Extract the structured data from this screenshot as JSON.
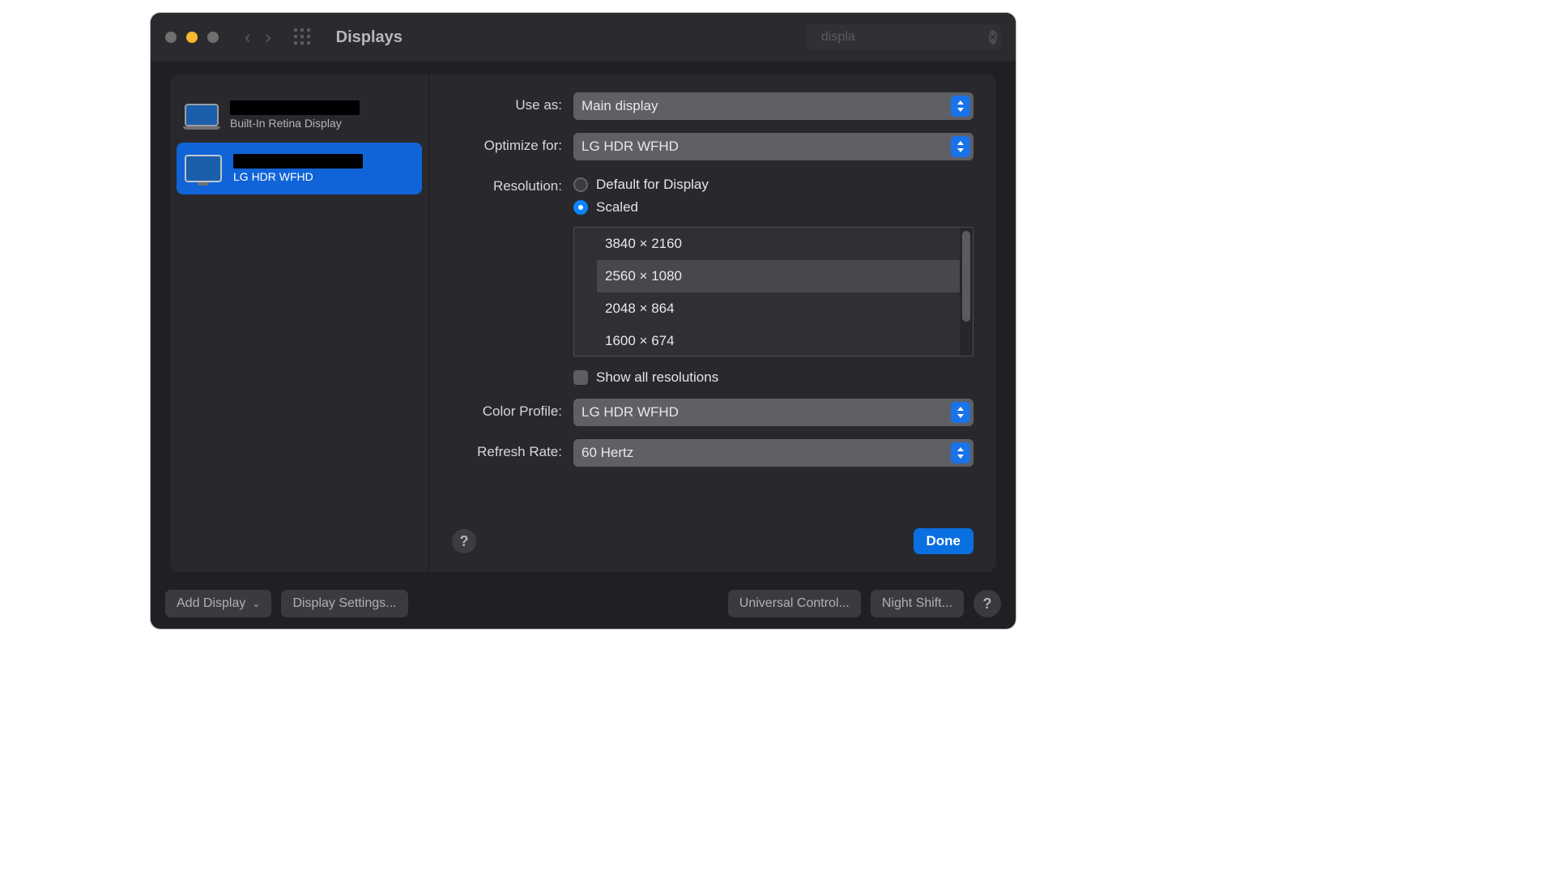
{
  "window": {
    "title": "Displays"
  },
  "search": {
    "query": "displa"
  },
  "sidebar": {
    "items": [
      {
        "subtitle": "Built-In Retina Display",
        "selected": false,
        "kind": "laptop"
      },
      {
        "subtitle": "LG HDR WFHD",
        "selected": true,
        "kind": "monitor"
      }
    ]
  },
  "form": {
    "use_as": {
      "label": "Use as:",
      "value": "Main display"
    },
    "optimize_for": {
      "label": "Optimize for:",
      "value": "LG HDR WFHD"
    },
    "resolution": {
      "label": "Resolution:",
      "options": {
        "default": "Default for Display",
        "scaled": "Scaled"
      },
      "selected": "scaled",
      "scaled_list": [
        "3840 × 2160",
        "2560 × 1080",
        "2048 × 864",
        "1600 × 674"
      ],
      "scaled_selected": "2560 × 1080",
      "show_all_label": "Show all resolutions",
      "show_all": false
    },
    "color_profile": {
      "label": "Color Profile:",
      "value": "LG HDR WFHD"
    },
    "refresh_rate": {
      "label": "Refresh Rate:",
      "value": "60 Hertz"
    }
  },
  "sheet_footer": {
    "done": "Done"
  },
  "bottom_bar": {
    "add_display": "Add Display",
    "display_settings": "Display Settings...",
    "universal_control": "Universal Control...",
    "night_shift": "Night Shift..."
  }
}
